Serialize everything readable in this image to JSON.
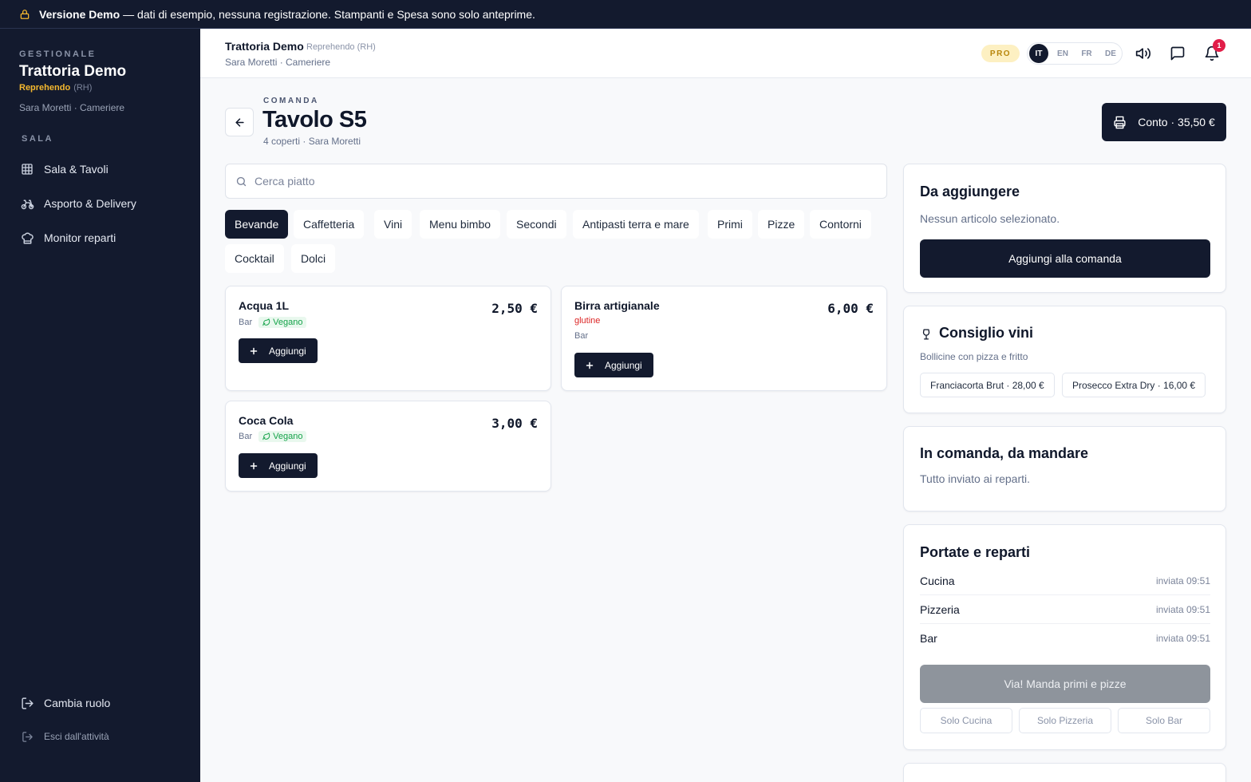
{
  "banner": {
    "bold": "Versione Demo",
    "text": "— dati di esempio, nessuna registrazione. Stampanti e Spesa sono solo anteprime."
  },
  "sidebar": {
    "eyebrow": "GESTIONALE",
    "title": "Trattoria Demo",
    "mode": "Reprehendo",
    "mode_code": "(RH)",
    "user": "Sara Moretti · Cameriere",
    "section": "SALA",
    "items": [
      {
        "label": "Sala & Tavoli",
        "icon": "grid-icon"
      },
      {
        "label": "Asporto & Delivery",
        "icon": "bike-icon"
      },
      {
        "label": "Monitor reparti",
        "icon": "chef-hat-icon"
      }
    ],
    "footer": [
      {
        "label": "Cambia ruolo",
        "icon": "logout-icon"
      },
      {
        "label": "Esci dall'attività",
        "icon": "exit-icon"
      }
    ]
  },
  "topbar": {
    "name": "Trattoria Demo",
    "mode": "Reprehendo (RH)",
    "user": "Sara Moretti · Cameriere",
    "plan": "PRO",
    "languages": [
      "IT",
      "EN",
      "FR",
      "DE"
    ],
    "active_language": "IT",
    "notifications": "1"
  },
  "order": {
    "eyebrow": "COMANDA",
    "title": "Tavolo S5",
    "subtitle": "4 coperti · Sara Moretti",
    "bill_button": "Conto · 35,50 €"
  },
  "search": {
    "placeholder": "Cerca piatto",
    "value": ""
  },
  "categories": [
    "Bevande",
    "Caffetteria",
    "Vini",
    "Menu bimbo",
    "Secondi",
    "Antipasti terra e mare",
    "Primi",
    "Pizze",
    "Contorni",
    "Cocktail",
    "Dolci"
  ],
  "active_category": "Bevande",
  "products": [
    {
      "name": "Acqua 1L",
      "price": "2,50 €",
      "dept": "Bar",
      "tag": "Vegano",
      "allergen": "",
      "add_label": "Aggiungi"
    },
    {
      "name": "Birra artigianale",
      "price": "6,00 €",
      "dept": "Bar",
      "tag": "",
      "allergen": "glutine",
      "add_label": "Aggiungi"
    },
    {
      "name": "Coca Cola",
      "price": "3,00 €",
      "dept": "Bar",
      "tag": "Vegano",
      "allergen": "",
      "add_label": "Aggiungi"
    }
  ],
  "to_add": {
    "title": "Da aggiungere",
    "empty": "Nessun articolo selezionato.",
    "button": "Aggiungi alla comanda"
  },
  "wine": {
    "title": "Consiglio vini",
    "subtitle": "Bollicine con pizza e fritto",
    "suggestions": [
      "Franciacorta Brut · 28,00 €",
      "Prosecco Extra Dry · 16,00 €"
    ]
  },
  "pending": {
    "title": "In comanda, da mandare",
    "text": "Tutto inviato ai reparti."
  },
  "courses": {
    "title": "Portate e reparti",
    "departments": [
      {
        "name": "Cucina",
        "status": "inviata 09:51"
      },
      {
        "name": "Pizzeria",
        "status": "inviata 09:51"
      },
      {
        "name": "Bar",
        "status": "inviata 09:51"
      }
    ],
    "send_button": "Via! Manda primi e pizze",
    "solo_buttons": [
      "Solo Cucina",
      "Solo Pizzeria",
      "Solo Bar"
    ]
  },
  "colors": {
    "navy": "#131a2e",
    "accent_yellow": "#f5b82e",
    "vegan_green": "#16a34a",
    "allergen_red": "#dc2626",
    "badge_red": "#e11d48"
  }
}
